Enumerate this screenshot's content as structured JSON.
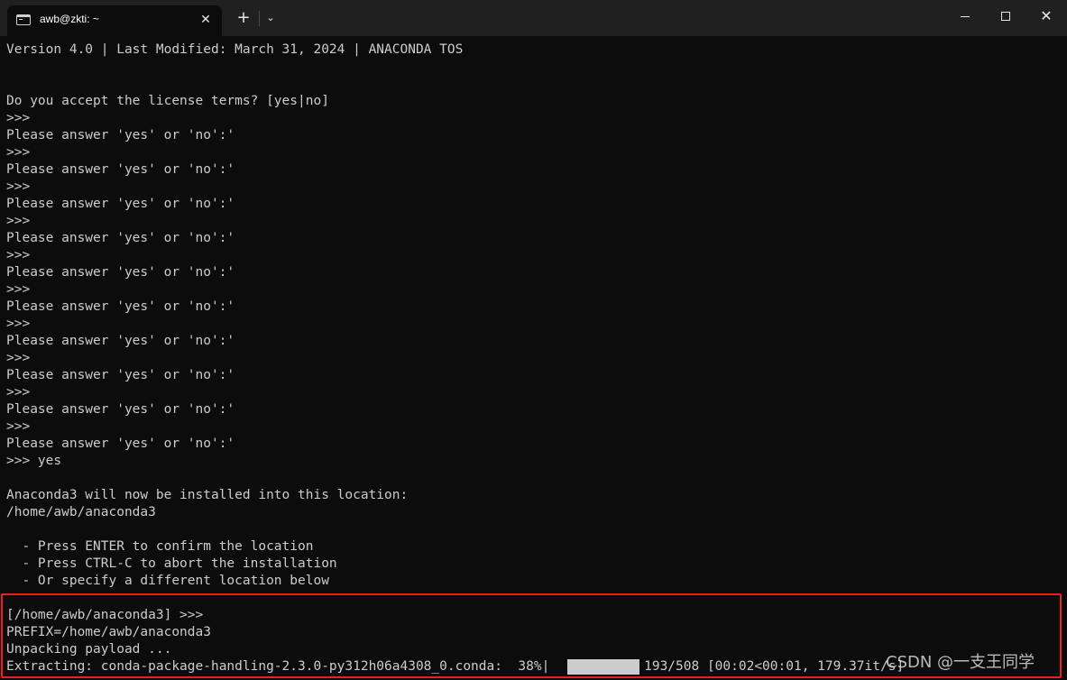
{
  "window": {
    "tab_title": "awb@zkti: ~",
    "tab_close": "✕",
    "new_tab": "+",
    "dropdown": "⌄",
    "close": "✕"
  },
  "terminal": {
    "lines": [
      "Version 4.0 | Last Modified: March 31, 2024 | ANACONDA TOS",
      "",
      "",
      "Do you accept the license terms? [yes|no]",
      ">>>",
      "Please answer 'yes' or 'no':'",
      ">>>",
      "Please answer 'yes' or 'no':'",
      ">>>",
      "Please answer 'yes' or 'no':'",
      ">>>",
      "Please answer 'yes' or 'no':'",
      ">>>",
      "Please answer 'yes' or 'no':'",
      ">>>",
      "Please answer 'yes' or 'no':'",
      ">>>",
      "Please answer 'yes' or 'no':'",
      ">>>",
      "Please answer 'yes' or 'no':'",
      ">>>",
      "Please answer 'yes' or 'no':'",
      ">>>",
      "Please answer 'yes' or 'no':'",
      ">>> yes",
      "",
      "Anaconda3 will now be installed into this location:",
      "/home/awb/anaconda3",
      "",
      "  - Press ENTER to confirm the location",
      "  - Press CTRL-C to abort the installation",
      "  - Or specify a different location below",
      "",
      "[/home/awb/anaconda3] >>>",
      "PREFIX=/home/awb/anaconda3",
      "Unpacking payload ...",
      "Extracting: conda-package-handling-2.3.0-py312h06a4308_0.conda:  38%|          | 193/508 [00:02<00:01, 179.37it/s]"
    ],
    "progress_percent": 38,
    "highlight_color": "#e8211c"
  },
  "watermark": "CSDN @一支王同学",
  "colors": {
    "background": "#0c0c0c",
    "titlebar": "#202020",
    "foreground": "#cccccc"
  }
}
